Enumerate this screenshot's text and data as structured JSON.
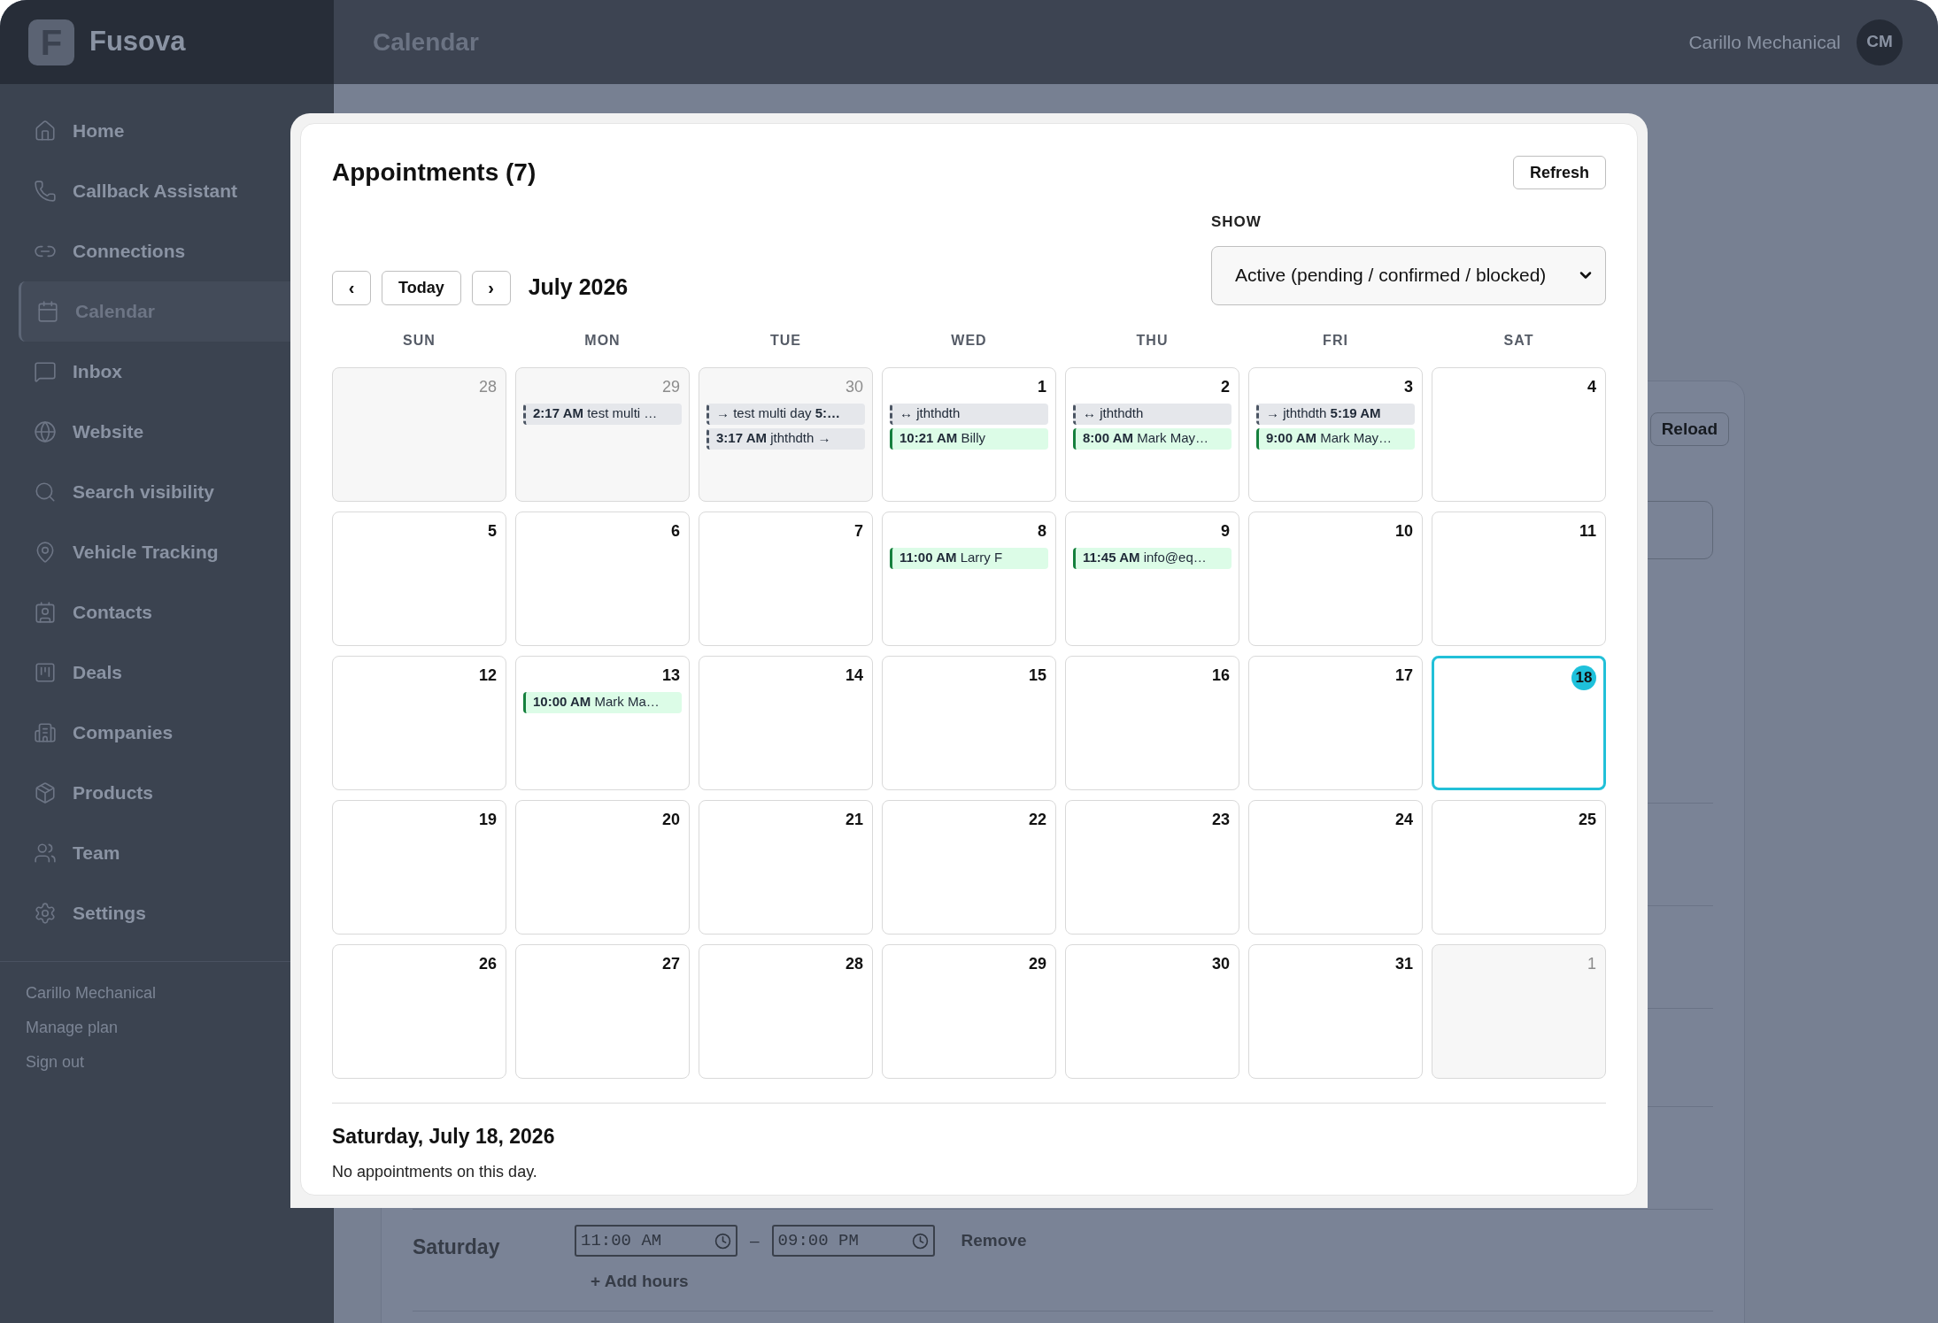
{
  "app": {
    "logo_letter": "F",
    "name": "Fusova"
  },
  "sidebar": {
    "items": [
      {
        "label": "Home",
        "selected": false
      },
      {
        "label": "Callback Assistant",
        "selected": false
      },
      {
        "label": "Connections",
        "selected": false
      },
      {
        "label": "Calendar",
        "selected": true
      },
      {
        "label": "Inbox",
        "selected": false
      },
      {
        "label": "Website",
        "selected": false
      },
      {
        "label": "Search visibility",
        "selected": false
      },
      {
        "label": "Vehicle Tracking",
        "selected": false
      },
      {
        "label": "Contacts",
        "selected": false
      },
      {
        "label": "Deals",
        "selected": false
      },
      {
        "label": "Companies",
        "selected": false
      },
      {
        "label": "Products",
        "selected": false
      },
      {
        "label": "Team",
        "selected": false
      },
      {
        "label": "Settings",
        "selected": false
      }
    ],
    "footer_links": [
      "Carillo Mechanical",
      "Manage plan",
      "Sign out"
    ]
  },
  "topbar": {
    "title": "Calendar",
    "account": "Carillo Mechanical",
    "avatar": "CM"
  },
  "background_panel": {
    "button": "Reload",
    "schedule_row": {
      "day": "Saturday",
      "start": "11:00 AM",
      "separator": "–",
      "end": "09:00 PM",
      "remove": "Remove",
      "add": "+ Add hours"
    }
  },
  "modal": {
    "title": "Appointments (7)",
    "refresh": "Refresh",
    "filter": {
      "label": "SHOW",
      "value": "Active (pending / confirmed / blocked)"
    },
    "nav": {
      "prev": "‹",
      "today": "Today",
      "next": "›"
    },
    "month": "July 2026",
    "weekdays": [
      "SUN",
      "MON",
      "TUE",
      "WED",
      "THU",
      "FRI",
      "SAT"
    ],
    "weeks": [
      [
        {
          "day": "28",
          "in_month": false,
          "selected": false
        },
        {
          "day": "29",
          "in_month": false,
          "selected": false,
          "events": [
            {
              "kind": "multi",
              "text": "**2:17 AM** test multi …"
            }
          ]
        },
        {
          "day": "30",
          "in_month": false,
          "selected": false,
          "events": [
            {
              "kind": "multi",
              "text": "→ test multi day **5:…**"
            },
            {
              "kind": "multi",
              "text": "**3:17 AM** jththdth →"
            }
          ]
        },
        {
          "day": "1",
          "in_month": true,
          "selected": false,
          "events": [
            {
              "kind": "multi",
              "text": "↔ jththdth"
            },
            {
              "kind": "single",
              "text": "**10:21 AM** Billy"
            }
          ]
        },
        {
          "day": "2",
          "in_month": true,
          "selected": false,
          "events": [
            {
              "kind": "multi",
              "text": "↔ jththdth"
            },
            {
              "kind": "single",
              "text": "**8:00 AM** Mark May…"
            }
          ]
        },
        {
          "day": "3",
          "in_month": true,
          "selected": false,
          "events": [
            {
              "kind": "multi",
              "text": "→ jththdth **5:19 AM**"
            },
            {
              "kind": "single",
              "text": "**9:00 AM** Mark May…"
            }
          ]
        },
        {
          "day": "4",
          "in_month": true,
          "selected": false
        }
      ],
      [
        {
          "day": "5",
          "in_month": true,
          "selected": false
        },
        {
          "day": "6",
          "in_month": true,
          "selected": false
        },
        {
          "day": "7",
          "in_month": true,
          "selected": false
        },
        {
          "day": "8",
          "in_month": true,
          "selected": false,
          "events": [
            {
              "kind": "single",
              "text": "**11:00 AM** Larry F"
            }
          ]
        },
        {
          "day": "9",
          "in_month": true,
          "selected": false,
          "events": [
            {
              "kind": "single",
              "text": "**11:45 AM** info@eq…"
            }
          ]
        },
        {
          "day": "10",
          "in_month": true,
          "selected": false
        },
        {
          "day": "11",
          "in_month": true,
          "selected": false
        }
      ],
      [
        {
          "day": "12",
          "in_month": true,
          "selected": false
        },
        {
          "day": "13",
          "in_month": true,
          "selected": false,
          "events": [
            {
              "kind": "single",
              "text": "**10:00 AM** Mark Ma…"
            }
          ]
        },
        {
          "day": "14",
          "in_month": true,
          "selected": false
        },
        {
          "day": "15",
          "in_month": true,
          "selected": false
        },
        {
          "day": "16",
          "in_month": true,
          "selected": false
        },
        {
          "day": "17",
          "in_month": true,
          "selected": false
        },
        {
          "day": "18",
          "in_month": true,
          "selected": true
        }
      ],
      [
        {
          "day": "19",
          "in_month": true,
          "selected": false
        },
        {
          "day": "20",
          "in_month": true,
          "selected": false
        },
        {
          "day": "21",
          "in_month": true,
          "selected": false
        },
        {
          "day": "22",
          "in_month": true,
          "selected": false
        },
        {
          "day": "23",
          "in_month": true,
          "selected": false
        },
        {
          "day": "24",
          "in_month": true,
          "selected": false
        },
        {
          "day": "25",
          "in_month": true,
          "selected": false
        }
      ],
      [
        {
          "day": "26",
          "in_month": true,
          "selected": false
        },
        {
          "day": "27",
          "in_month": true,
          "selected": false
        },
        {
          "day": "28",
          "in_month": true,
          "selected": false
        },
        {
          "day": "29",
          "in_month": true,
          "selected": false
        },
        {
          "day": "30",
          "in_month": true,
          "selected": false
        },
        {
          "day": "31",
          "in_month": true,
          "selected": false
        },
        {
          "day": "1",
          "in_month": false,
          "selected": false
        }
      ]
    ],
    "day_detail": {
      "title": "Saturday, July 18, 2026",
      "message": "No appointments on this day."
    }
  }
}
